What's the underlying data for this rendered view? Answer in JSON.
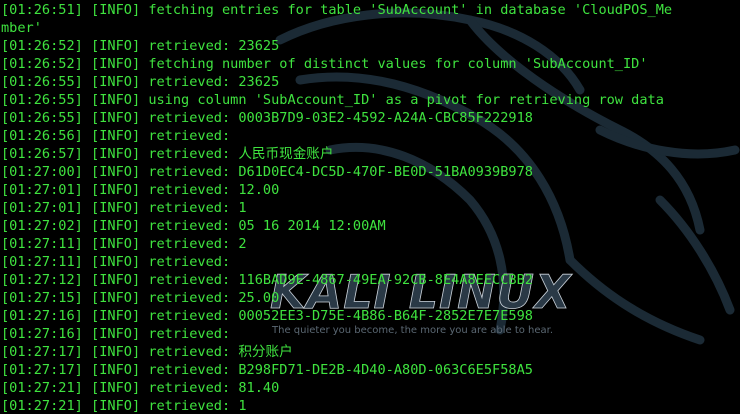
{
  "wallpaper": {
    "logo_text": "KALI LINUX",
    "tagline": "The quieter you become, the more you are able to hear."
  },
  "log_lines": [
    "[01:26:51] [INFO] fetching entries for table 'SubAccount' in database 'CloudPOS_Me",
    "mber'",
    "[01:26:52] [INFO] retrieved: 23625",
    "[01:26:52] [INFO] fetching number of distinct values for column 'SubAccount_ID'",
    "[01:26:55] [INFO] retrieved: 23625",
    "[01:26:55] [INFO] using column 'SubAccount_ID' as a pivot for retrieving row data",
    "[01:26:55] [INFO] retrieved: 0003B7D9-03E2-4592-A24A-CBC85F222918",
    "[01:26:56] [INFO] retrieved:",
    "[01:26:57] [INFO] retrieved: 人民币现金账户",
    "[01:27:00] [INFO] retrieved: D61D0EC4-DC5D-470F-BE0D-51BA0939B978",
    "[01:27:01] [INFO] retrieved: 12.00",
    "[01:27:01] [INFO] retrieved: 1",
    "[01:27:02] [INFO] retrieved: 05 16 2014 12:00AM",
    "[01:27:11] [INFO] retrieved: 2",
    "[01:27:11] [INFO] retrieved:",
    "[01:27:12] [INFO] retrieved: 116BAD9E-4867-49EA-92CB-8E4A8EECCBB2",
    "[01:27:15] [INFO] retrieved: 25.00",
    "[01:27:16] [INFO] retrieved: 00052EE3-D75E-4B86-B64F-2852E7E7E598",
    "[01:27:16] [INFO] retrieved:",
    "[01:27:17] [INFO] retrieved: 积分账户",
    "[01:27:17] [INFO] retrieved: B298FD71-DE2B-4D40-A80D-063C6E5F58A5",
    "[01:27:21] [INFO] retrieved: 81.40",
    "[01:27:21] [INFO] retrieved: 1"
  ],
  "colors": {
    "background": "#000000",
    "text": "#3fe33f"
  }
}
